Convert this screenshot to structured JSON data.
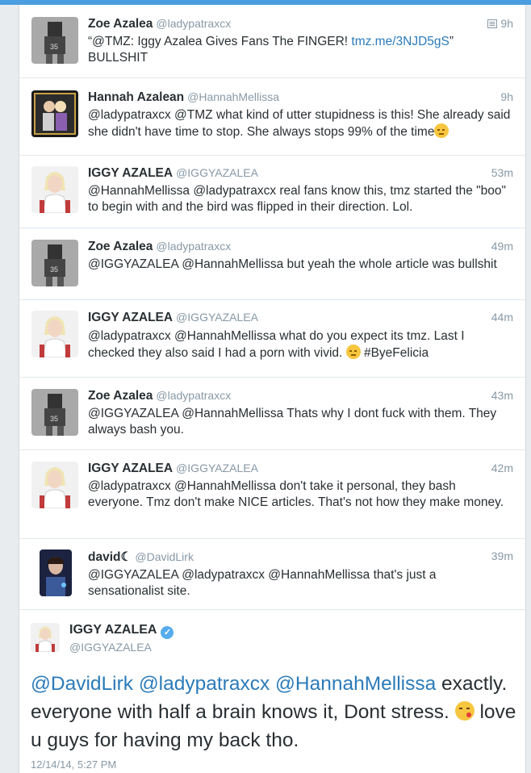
{
  "tweets": [
    {
      "name": "Zoe Azalea",
      "handle": "@ladypatraxcx",
      "time": "9h",
      "avatar": "zoe",
      "parts": [
        [
          "text",
          "“@TMZ: Iggy Azalea Gives Fans The FINGER! "
        ],
        [
          "link",
          "tmz.me/3NJD5gS"
        ],
        [
          "text",
          "” BULLSHIT"
        ]
      ]
    },
    {
      "name": "Hannah Azalean",
      "handle": "@HannahMellissa",
      "time": "9h",
      "avatar": "hannah",
      "parts": [
        [
          "text",
          "@ladypatraxcx @TMZ what kind of utter stupidness is this! She already said she didn't have time to stop. She always stops 99% of the time"
        ],
        [
          "emoji",
          "unamused"
        ]
      ]
    },
    {
      "name": "IGGY AZALEA",
      "handle": "@IGGYAZALEA",
      "time": "53m",
      "avatar": "iggy",
      "parts": [
        [
          "text",
          "@HannahMellissa @ladypatraxcx real fans know this, tmz started the \"boo\" to begin with and the bird was flipped in their direction. Lol."
        ]
      ]
    },
    {
      "name": "Zoe Azalea",
      "handle": "@ladypatraxcx",
      "time": "49m",
      "avatar": "zoe",
      "parts": [
        [
          "text",
          "@IGGYAZALEA @HannahMellissa but yeah the whole article was bullshit"
        ]
      ]
    },
    {
      "name": "IGGY AZALEA",
      "handle": "@IGGYAZALEA",
      "time": "44m",
      "avatar": "iggy",
      "parts": [
        [
          "text",
          "@ladypatraxcx @HannahMellissa what do you expect its tmz. Last I checked they also said I had a porn with vivid. "
        ],
        [
          "emoji",
          "unamused"
        ],
        [
          "text",
          " #ByeFelicia"
        ]
      ]
    },
    {
      "name": "Zoe Azalea",
      "handle": "@ladypatraxcx",
      "time": "43m",
      "avatar": "zoe",
      "parts": [
        [
          "text",
          "@IGGYAZALEA @HannahMellissa Thats why I dont fuck with them. They always bash you."
        ]
      ]
    },
    {
      "name": "IGGY AZALEA",
      "handle": "@IGGYAZALEA",
      "time": "42m",
      "avatar": "iggy",
      "parts": [
        [
          "text",
          "@ladypatraxcx @HannahMellissa don't take it personal, they bash everyone. Tmz don't make NICE articles. That's not how they make money."
        ]
      ]
    },
    {
      "name": "david☾",
      "handle": "@DavidLirk",
      "time": "39m",
      "avatar": "david",
      "parts": [
        [
          "text",
          "@IGGYAZALEA @ladypatraxcx @HannahMellissa that's just a sensationalist site."
        ]
      ]
    }
  ],
  "main_tweet": {
    "name": "IGGY AZALEA",
    "handle": "@IGGYAZALEA",
    "mentions": [
      "@DavidLirk",
      "@ladypatraxcx",
      "@HannahMellissa"
    ],
    "text_before_emoji": " exactly. everyone with half a brain knows it, Dont stress. ",
    "text_after_emoji": " love u guys for having my back tho.",
    "date": "12/14/14, 5:27 PM",
    "emoji": "kissing-face"
  },
  "colors": {
    "link": "#2b7bb9",
    "muted": "#8899a6",
    "verified": "#55acee",
    "accent": "#4a9ee0"
  },
  "icons": {
    "details": "tweet-details-icon",
    "verified": "verified-badge-icon"
  }
}
